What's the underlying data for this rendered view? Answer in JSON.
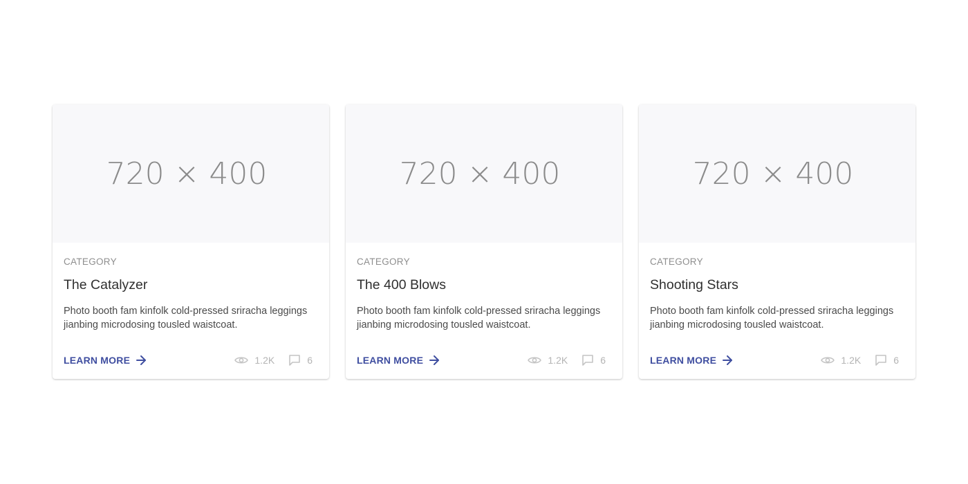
{
  "image_placeholder": "720 × 400",
  "cards": [
    {
      "category": "CATEGORY",
      "title": "The Catalyzer",
      "description": "Photo booth fam kinfolk cold-pressed sriracha leggings jianbing microdosing tousled waistcoat.",
      "learn_more_label": "LEARN MORE",
      "views": "1.2K",
      "comments": "6"
    },
    {
      "category": "CATEGORY",
      "title": "The 400 Blows",
      "description": "Photo booth fam kinfolk cold-pressed sriracha leggings jianbing microdosing tousled waistcoat.",
      "learn_more_label": "LEARN MORE",
      "views": "1.2K",
      "comments": "6"
    },
    {
      "category": "CATEGORY",
      "title": "Shooting Stars",
      "description": "Photo booth fam kinfolk cold-pressed sriracha leggings jianbing microdosing tousled waistcoat.",
      "learn_more_label": "LEARN MORE",
      "views": "1.2K",
      "comments": "6"
    }
  ],
  "icons": {
    "learn_more": "arrow-right-icon",
    "views": "eye-icon",
    "comments": "comment-icon"
  },
  "colors": {
    "accent": "#3f4ea0",
    "muted": "#b4b4b4",
    "image_bg": "#f8f8fa",
    "placeholder_text": "#8b8b8b"
  }
}
